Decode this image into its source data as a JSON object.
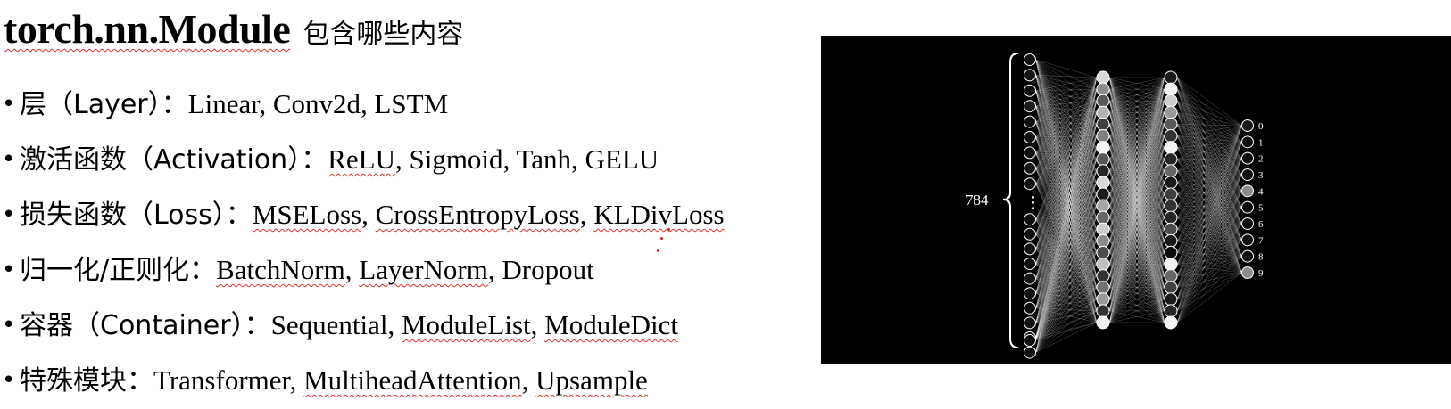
{
  "title": {
    "main": "torch.nn.Module",
    "sub": "包含哪些内容"
  },
  "bullets": [
    {
      "category": "层（Layer）：",
      "items": [
        {
          "text": "Linear",
          "squiggle": false
        },
        {
          "text": "Conv2d",
          "squiggle": false
        },
        {
          "text": "LSTM",
          "squiggle": false
        }
      ]
    },
    {
      "category": "激活函数（Activation）：",
      "items": [
        {
          "text": "ReLU",
          "squiggle": true
        },
        {
          "text": "Sigmoid",
          "squiggle": false
        },
        {
          "text": "Tanh",
          "squiggle": false
        },
        {
          "text": "GELU",
          "squiggle": false
        }
      ]
    },
    {
      "category": "损失函数（Loss）：",
      "items": [
        {
          "text": "MSELoss",
          "squiggle": true
        },
        {
          "text": "CrossEntropyLoss",
          "squiggle": true
        },
        {
          "text": "KLDivLoss",
          "squiggle": true
        }
      ]
    },
    {
      "category": "归一化/正则化：",
      "items": [
        {
          "text": "BatchNorm",
          "squiggle": true
        },
        {
          "text": "LayerNorm",
          "squiggle": true
        },
        {
          "text": "Dropout",
          "squiggle": false
        }
      ]
    },
    {
      "category": "容器（Container）：",
      "items": [
        {
          "text": "Sequential",
          "squiggle": false
        },
        {
          "text": "ModuleList",
          "squiggle": true
        },
        {
          "text": "ModuleDict",
          "squiggle": true
        }
      ]
    },
    {
      "category": "特殊模块：",
      "items": [
        {
          "text": "Transformer",
          "squiggle": false
        },
        {
          "text": "MultiheadAttention",
          "squiggle": true
        },
        {
          "text": "Upsample",
          "squiggle": true
        }
      ]
    }
  ],
  "network": {
    "input_size_label": "784",
    "input_ellipsis": "⋮",
    "output_labels": [
      "0",
      "1",
      "2",
      "3",
      "4",
      "5",
      "6",
      "7",
      "8",
      "9"
    ],
    "input_activations": [
      0.05,
      0.08,
      0.04,
      0.1,
      0.06,
      0.07,
      0.05,
      0.09,
      0.06,
      0.05,
      0.05,
      0.07,
      0.04,
      0.08,
      0.06,
      0.05,
      0.07,
      0.04,
      0.06,
      0.05
    ],
    "hidden1_activations": [
      0.85,
      0.55,
      0.35,
      0.7,
      0.25,
      0.5,
      0.95,
      0.35,
      0.15,
      0.85,
      0.1,
      0.65,
      0.4,
      0.8,
      0.55,
      0.3,
      0.75,
      0.2,
      0.45,
      0.6,
      0.2,
      0.95
    ],
    "hidden2_activations": [
      0.1,
      0.95,
      0.8,
      0.6,
      0.35,
      0.2,
      0.95,
      0.15,
      0.4,
      0.1,
      0.25,
      0.2,
      0.15,
      0.3,
      0.1,
      0.05,
      0.95,
      0.4,
      0.25,
      0.1,
      0.15,
      0.95
    ],
    "output_activations": [
      0.1,
      0.05,
      0.05,
      0.05,
      0.55,
      0.05,
      0.05,
      0.05,
      0.05,
      0.55
    ],
    "colors": {
      "background": "#000000",
      "stroke": "#ffffff",
      "squiggle": "#dd3333"
    }
  }
}
